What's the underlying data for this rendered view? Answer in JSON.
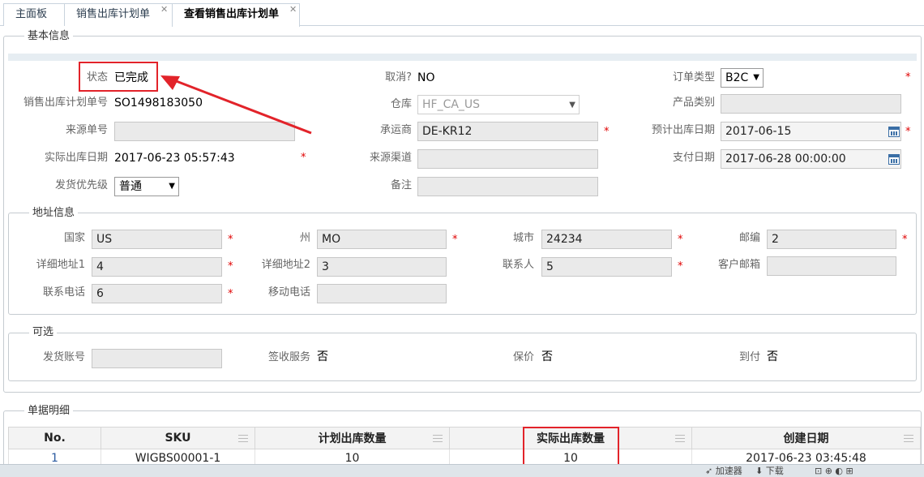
{
  "tabs": [
    {
      "label": "主面板"
    },
    {
      "label": "销售出库计划单"
    },
    {
      "label": "查看销售出库计划单"
    }
  ],
  "basic": {
    "legend": "基本信息",
    "status_label": "状态",
    "status_value": "已完成",
    "cancel_label": "取消?",
    "cancel_value": "NO",
    "order_type_label": "订单类型",
    "order_type_value": "B2C",
    "plan_no_label": "销售出库计划单号",
    "plan_no_value": "SO1498183050",
    "warehouse_label": "仓库",
    "warehouse_value": "HF_CA_US",
    "product_cat_label": "产品类别",
    "product_cat_value": "",
    "source_no_label": "来源单号",
    "source_no_value": "",
    "carrier_label": "承运商",
    "carrier_value": "DE-KR12",
    "est_date_label": "预计出库日期",
    "est_date_value": "2017-06-15",
    "actual_date_label": "实际出库日期",
    "actual_date_value": "2017-06-23 05:57:43",
    "source_channel_label": "来源渠道",
    "source_channel_value": "",
    "pay_date_label": "支付日期",
    "pay_date_value": "2017-06-28 00:00:00",
    "priority_label": "发货优先级",
    "priority_value": "普通",
    "remark_label": "备注",
    "remark_value": ""
  },
  "address": {
    "legend": "地址信息",
    "country_label": "国家",
    "country_value": "US",
    "state_label": "州",
    "state_value": "MO",
    "city_label": "城市",
    "city_value": "24234",
    "zip_label": "邮编",
    "zip_value": "2",
    "addr1_label": "详细地址1",
    "addr1_value": "4",
    "addr2_label": "详细地址2",
    "addr2_value": "3",
    "contact_label": "联系人",
    "contact_value": "5",
    "email_label": "客户邮箱",
    "email_value": "",
    "phone_label": "联系电话",
    "phone_value": "6",
    "mobile_label": "移动电话",
    "mobile_value": ""
  },
  "optional": {
    "legend": "可选",
    "ship_acct_label": "发货账号",
    "ship_acct_value": "",
    "sign_label": "签收服务",
    "sign_value": "否",
    "insure_label": "保价",
    "insure_value": "否",
    "cod_label": "到付",
    "cod_value": "否"
  },
  "detail": {
    "legend": "单据明细",
    "columns": [
      "No.",
      "SKU",
      "计划出库数量",
      "实际出库数量",
      "创建日期"
    ],
    "rows": [
      {
        "no": "1",
        "sku": "WIGBS00001-1",
        "plan_qty": "10",
        "actual_qty": "10",
        "created": "2017-06-23 03:45:48"
      }
    ]
  },
  "statusbar": {
    "accelerate": "加速器",
    "download": "下载"
  },
  "colors": {
    "highlight": "#e2232a",
    "required": "#e00000",
    "tab_border": "#c9d3dd",
    "info_band": "#e6edf2"
  }
}
